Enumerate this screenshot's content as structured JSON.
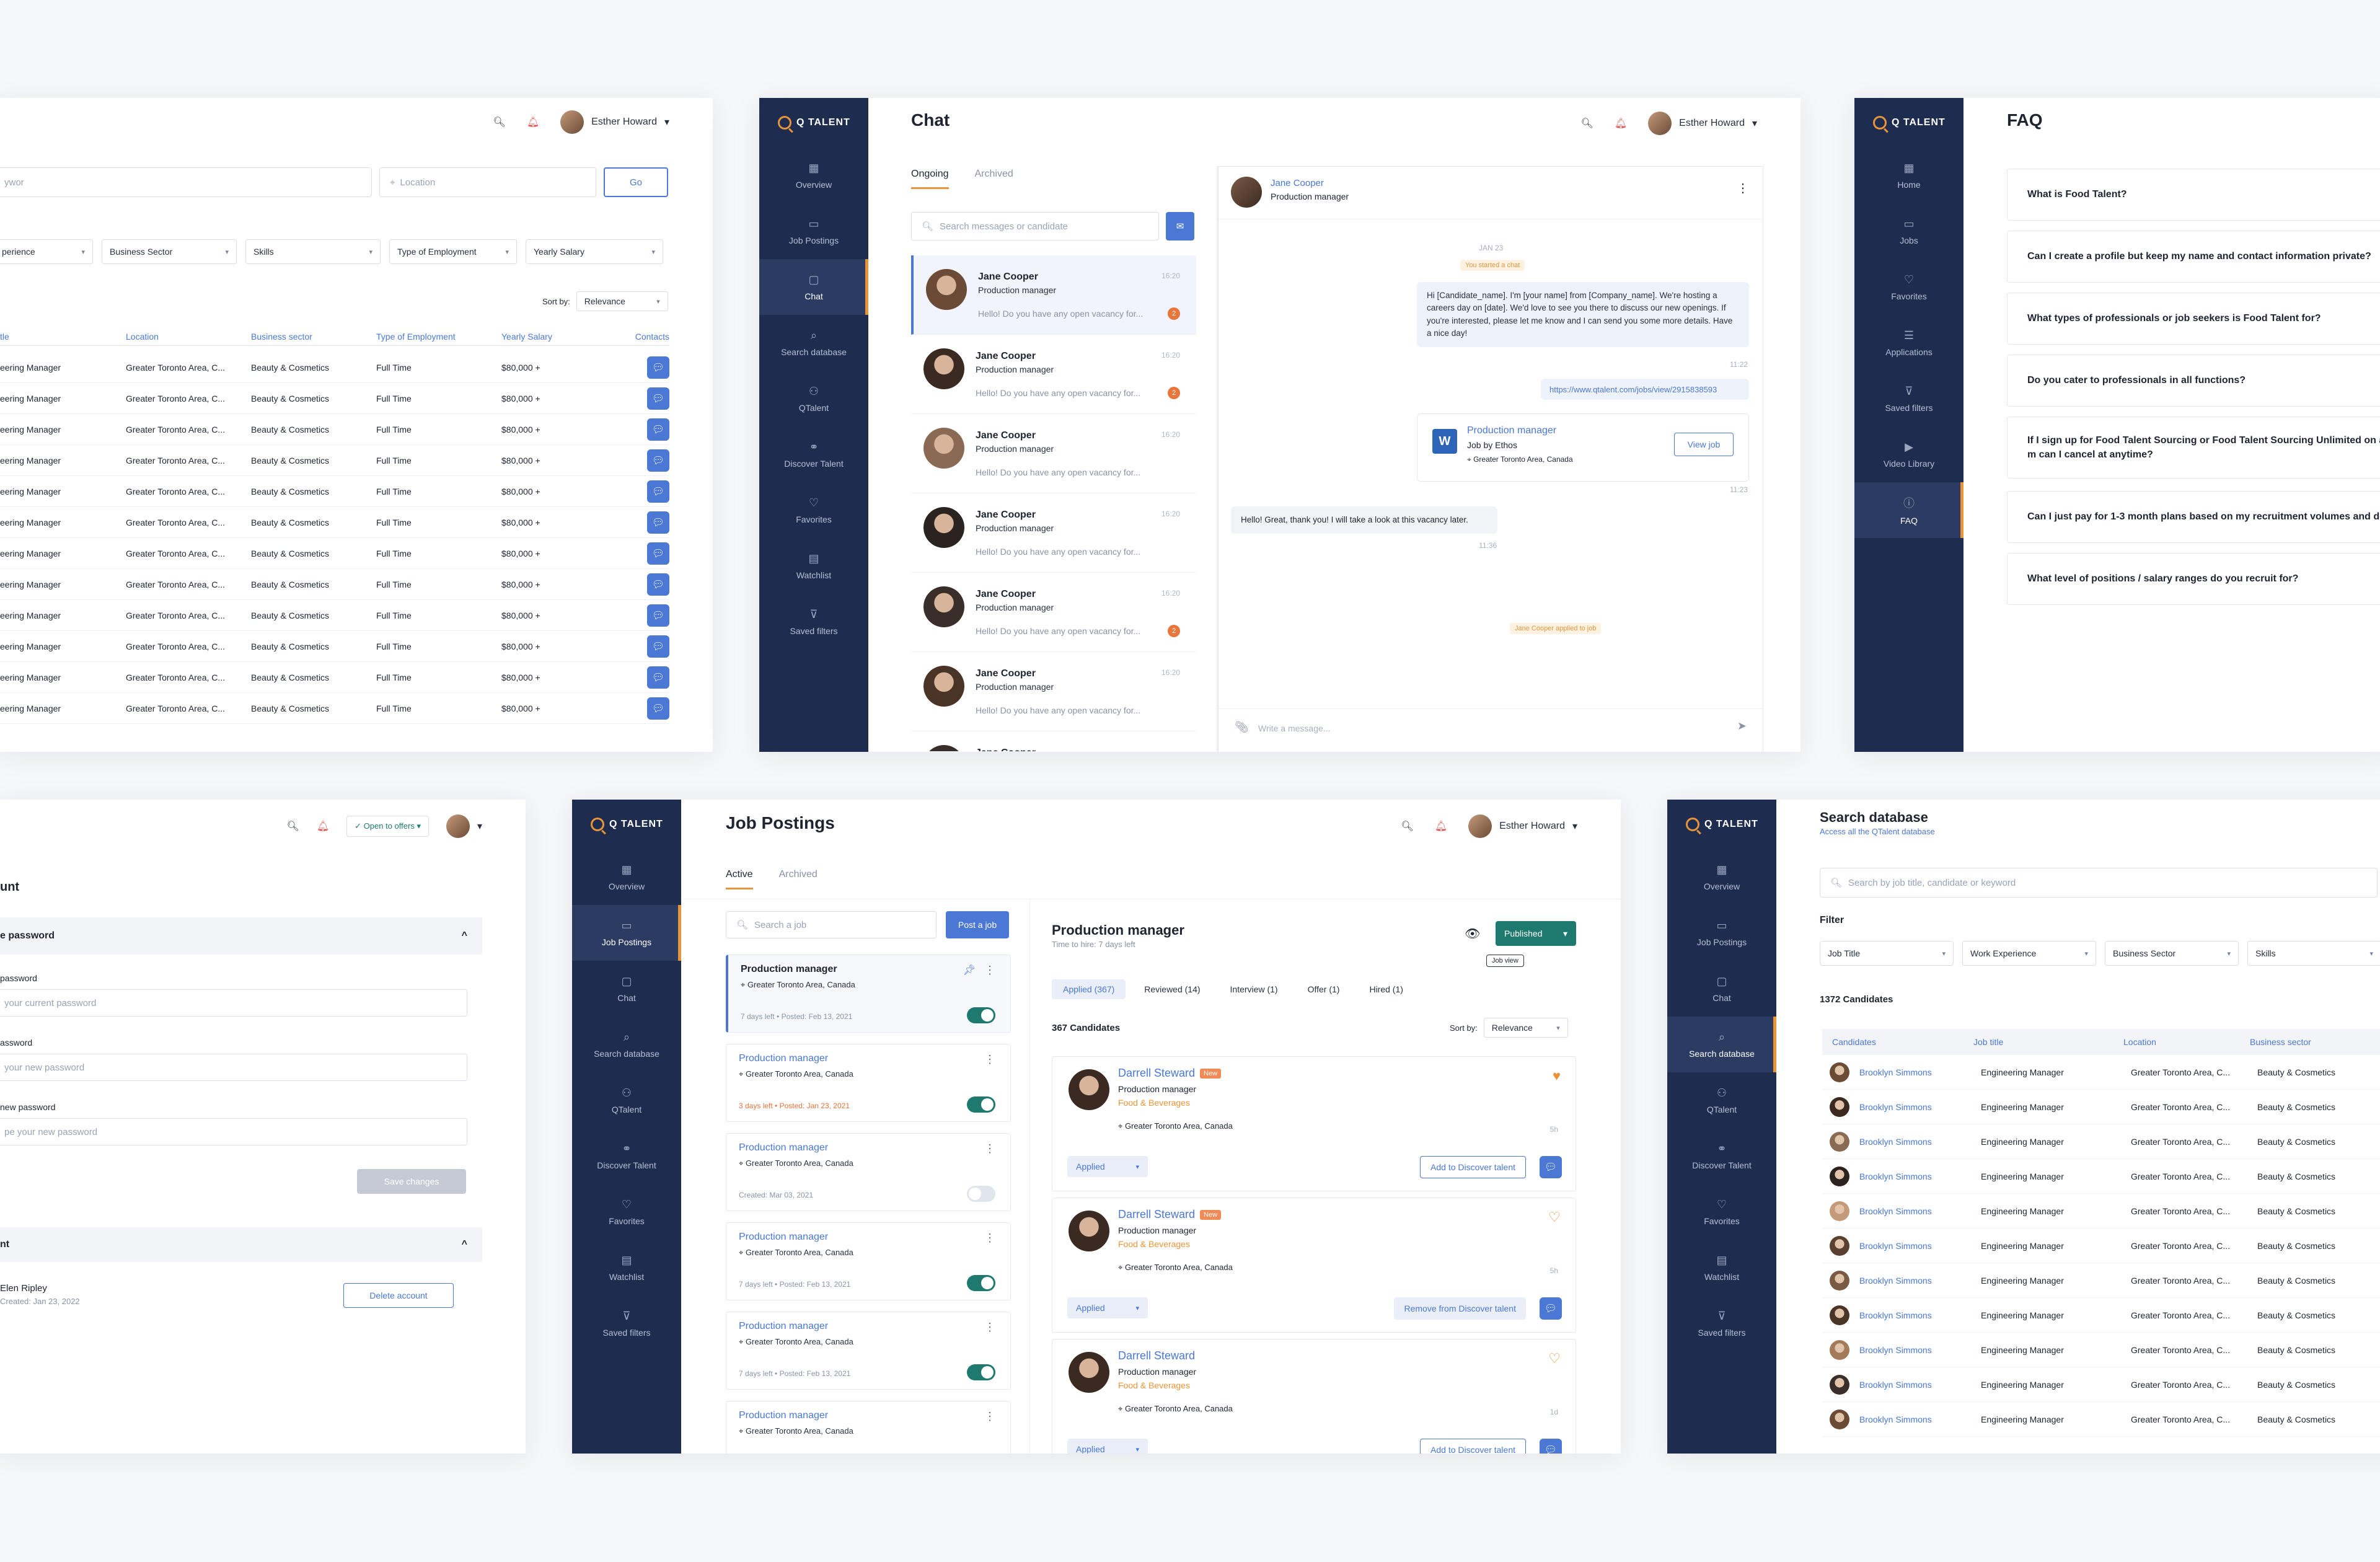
{
  "brand": "Q TALENT",
  "user": "Esther Howard",
  "p1": {
    "search_placeholder": "ywor",
    "location_placeholder": "Location",
    "go": "Go",
    "filters": [
      "perience",
      "Business Sector",
      "Skills",
      "Type of Employment",
      "Yearly Salary"
    ],
    "sortby_label": "Sort by:",
    "sortby_value": "Relevance",
    "columns": [
      "tle",
      "Location",
      "Business sector",
      "Type of Employment",
      "Yearly Salary",
      "Contacts"
    ],
    "rows": [
      [
        "eering Manager",
        "Greater Toronto Area, C...",
        "Beauty & Cosmetics",
        "Full Time",
        "$80,000 +"
      ],
      [
        "eering Manager",
        "Greater Toronto Area, C...",
        "Beauty & Cosmetics",
        "Full Time",
        "$80,000 +"
      ],
      [
        "eering Manager",
        "Greater Toronto Area, C...",
        "Beauty & Cosmetics",
        "Full Time",
        "$80,000 +"
      ],
      [
        "eering Manager",
        "Greater Toronto Area, C...",
        "Beauty & Cosmetics",
        "Full Time",
        "$80,000 +"
      ],
      [
        "eering Manager",
        "Greater Toronto Area, C...",
        "Beauty & Cosmetics",
        "Full Time",
        "$80,000 +"
      ],
      [
        "eering Manager",
        "Greater Toronto Area, C...",
        "Beauty & Cosmetics",
        "Full Time",
        "$80,000 +"
      ],
      [
        "eering Manager",
        "Greater Toronto Area, C...",
        "Beauty & Cosmetics",
        "Full Time",
        "$80,000 +"
      ],
      [
        "eering Manager",
        "Greater Toronto Area, C...",
        "Beauty & Cosmetics",
        "Full Time",
        "$80,000 +"
      ],
      [
        "eering Manager",
        "Greater Toronto Area, C...",
        "Beauty & Cosmetics",
        "Full Time",
        "$80,000 +"
      ],
      [
        "eering Manager",
        "Greater Toronto Area, C...",
        "Beauty & Cosmetics",
        "Full Time",
        "$80,000 +"
      ],
      [
        "eering Manager",
        "Greater Toronto Area, C...",
        "Beauty & Cosmetics",
        "Full Time",
        "$80,000 +"
      ],
      [
        "eering Manager",
        "Greater Toronto Area, C...",
        "Beauty & Cosmetics",
        "Full Time",
        "$80,000 +"
      ]
    ]
  },
  "chat": {
    "title": "Chat",
    "nav": [
      "Overview",
      "Job Postings",
      "Chat",
      "Search database",
      "QTalent",
      "Discover Talent",
      "Favorites",
      "Watchlist",
      "Saved filters"
    ],
    "tabs": [
      "Ongoing",
      "Archived"
    ],
    "search_placeholder": "Search messages or candidate",
    "convs": [
      {
        "name": "Jane Cooper",
        "role": "Production manager",
        "msg": "Hello! Do you have any open vacancy for...",
        "time": "16:20",
        "badge": "2"
      },
      {
        "name": "Jane Cooper",
        "role": "Production manager",
        "msg": "Hello! Do you have any open vacancy for...",
        "time": "16:20",
        "badge": "2"
      },
      {
        "name": "Jane Cooper",
        "role": "Production manager",
        "msg": "Hello! Do you have any open vacancy for...",
        "time": "16:20",
        "badge": ""
      },
      {
        "name": "Jane Cooper",
        "role": "Production manager",
        "msg": "Hello! Do you have any open vacancy for...",
        "time": "16:20",
        "badge": ""
      },
      {
        "name": "Jane Cooper",
        "role": "Production manager",
        "msg": "Hello! Do you have any open vacancy for...",
        "time": "16:20",
        "badge": "2"
      },
      {
        "name": "Jane Cooper",
        "role": "Production manager",
        "msg": "Hello! Do you have any open vacancy for...",
        "time": "16:20",
        "badge": ""
      }
    ],
    "conv_partial": "Jane Cooper",
    "header_name": "Jane Cooper",
    "header_role": "Production manager",
    "date": "JAN 23",
    "system1": "You started a chat",
    "msg1": "Hi [Candidate_name]. I'm [your name] from [Company_name]. We're hosting a careers day on [date]. We'd love to see you there to discuss our new openings. If you're interested, please let me know and I can send you some more details. Have a nice day!",
    "time1": "11:22",
    "link": "https://www.qtalent.com/jobs/view/2915838593",
    "card_title": "Production manager",
    "card_sub": "Job by Ethos",
    "card_loc": "Greater Toronto Area, Canada",
    "card_btn": "View job",
    "card_logo": "W",
    "time2": "11:23",
    "reply": "Hello! Great, thank you! I will take a look at this vacancy later.",
    "time3": "11:36",
    "system2": "Jane Cooper applied to job",
    "input_placeholder": "Write a message..."
  },
  "faq": {
    "title": "FAQ",
    "nav": [
      "Home",
      "Jobs",
      "Favorites",
      "Applications",
      "Saved filters",
      "Video Library",
      "FAQ"
    ],
    "items": [
      "What is Food Talent?",
      "Can I create a profile but keep my name and contact information private?",
      "What types of professionals or job seekers is Food Talent for?",
      "Do you cater to professionals in all functions?",
      "If I sign up for Food Talent Sourcing or Food Talent Sourcing Unlimited on a m can I cancel at anytime?",
      "Can I just pay for 1-3 month plans based on my recruitment volumes and dem",
      "What level of positions / salary ranges do you recruit for?"
    ]
  },
  "account": {
    "offers": "Open to offers",
    "title": "unt",
    "section1": "e password",
    "l1": "password",
    "p1": "your current password",
    "l2": "assword",
    "p2": "your new password",
    "l3": "new password",
    "p3": "pe your new password",
    "save": "Save changes",
    "section2": "nt",
    "name": "Elen Ripley",
    "created": "Created: Jan 23, 2022",
    "delete": "Delete account"
  },
  "jobs": {
    "title": "Job Postings",
    "nav": [
      "Overview",
      "Job Postings",
      "Chat",
      "Search database",
      "QTalent",
      "Discover Talent",
      "Favorites",
      "Watchlist",
      "Saved filters"
    ],
    "tabs": [
      "Active",
      "Archived"
    ],
    "search_placeholder": "Search a job",
    "post": "Post a job",
    "list": [
      {
        "title": "Production manager",
        "loc": "Greater Toronto Area, Canada",
        "foot": "7 days left  •  Posted: Feb 13, 2021",
        "on": true
      },
      {
        "title": "Production manager",
        "loc": "Greater Toronto Area, Canada",
        "foot": "3 days left  •  Posted: Jan 23, 2021",
        "on": true
      },
      {
        "title": "Production manager",
        "loc": "Greater Toronto Area, Canada",
        "foot": "Created: Mar 03, 2021",
        "on": false
      },
      {
        "title": "Production manager",
        "loc": "Greater Toronto Area, Canada",
        "foot": "7 days left  •  Posted: Feb 13, 2021",
        "on": true
      },
      {
        "title": "Production manager",
        "loc": "Greater Toronto Area, Canada",
        "foot": "7 days left  •  Posted: Feb 13, 2021",
        "on": true
      },
      {
        "title": "Production manager",
        "loc": "Greater Toronto Area, Canada",
        "foot": "",
        "on": true
      }
    ],
    "detail_title": "Production manager",
    "detail_sub": "Time to hire: 7 days left",
    "status": "Published",
    "tooltip": "Job view",
    "stages": [
      "Applied (367)",
      "Reviewed (14)",
      "Interview (1)",
      "Offer (1)",
      "Hired (1)"
    ],
    "count": "367 Candidates",
    "sortby_label": "Sort by:",
    "sortby_value": "Relevance",
    "cands": [
      {
        "name": "Darrell Steward",
        "new": "New",
        "role": "Production manager",
        "ind": "Food & Beverages",
        "loc": "Greater Toronto Area, Canada",
        "ago": "5h",
        "status": "Applied",
        "action": "Add to Discover talent"
      },
      {
        "name": "Darrell Steward",
        "new": "New",
        "role": "Production manager",
        "ind": "Food & Beverages",
        "loc": "Greater Toronto Area, Canada",
        "ago": "5h",
        "status": "Applied",
        "action": "Remove from Discover talent"
      },
      {
        "name": "Darrell Steward",
        "new": "",
        "role": "Production manager",
        "ind": "Food & Beverages",
        "loc": "Greater Toronto Area, Canada",
        "ago": "1d",
        "status": "Applied",
        "action": "Add to Discover talent"
      }
    ]
  },
  "sdb": {
    "title": "Search database",
    "subtitle": "Access all the QTalent database",
    "search_placeholder": "Search by job title, candidate or keyword",
    "filter_label": "Filter",
    "filters": [
      "Job Title",
      "Work Experience",
      "Business Sector",
      "Skills"
    ],
    "count": "1372 Candidates",
    "columns": [
      "Candidates",
      "Job title",
      "Location",
      "Business sector"
    ],
    "rows": [
      [
        "Brooklyn Simmons",
        "Engineering Manager",
        "Greater Toronto Area, C...",
        "Beauty & Cosmetics"
      ],
      [
        "Brooklyn Simmons",
        "Engineering Manager",
        "Greater Toronto Area, C...",
        "Beauty & Cosmetics"
      ],
      [
        "Brooklyn Simmons",
        "Engineering Manager",
        "Greater Toronto Area, C...",
        "Beauty & Cosmetics"
      ],
      [
        "Brooklyn Simmons",
        "Engineering Manager",
        "Greater Toronto Area, C...",
        "Beauty & Cosmetics"
      ],
      [
        "Brooklyn Simmons",
        "Engineering Manager",
        "Greater Toronto Area, C...",
        "Beauty & Cosmetics"
      ],
      [
        "Brooklyn Simmons",
        "Engineering Manager",
        "Greater Toronto Area, C...",
        "Beauty & Cosmetics"
      ],
      [
        "Brooklyn Simmons",
        "Engineering Manager",
        "Greater Toronto Area, C...",
        "Beauty & Cosmetics"
      ],
      [
        "Brooklyn Simmons",
        "Engineering Manager",
        "Greater Toronto Area, C...",
        "Beauty & Cosmetics"
      ],
      [
        "Brooklyn Simmons",
        "Engineering Manager",
        "Greater Toronto Area, C...",
        "Beauty & Cosmetics"
      ],
      [
        "Brooklyn Simmons",
        "Engineering Manager",
        "Greater Toronto Area, C...",
        "Beauty & Cosmetics"
      ],
      [
        "Brooklyn Simmons",
        "Engineering Manager",
        "Greater Toronto Area, C...",
        "Beauty & Cosmetics"
      ]
    ]
  }
}
